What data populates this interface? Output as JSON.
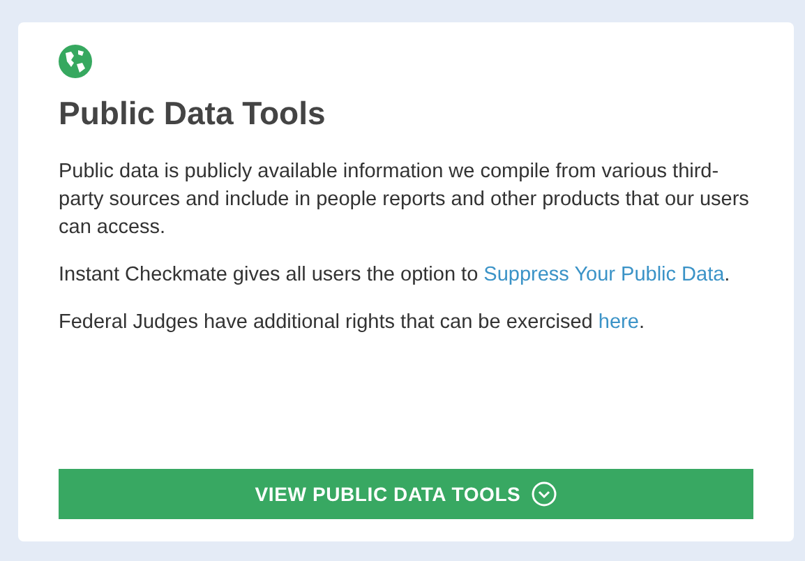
{
  "card": {
    "title": "Public Data Tools",
    "paragraphs": [
      {
        "text": "Public data is publicly available information we compile from various third-party sources and include in people reports and other products that our users can access."
      },
      {
        "text": "Instant Checkmate gives all users the option to ",
        "link": "Suppress Your Public Data",
        "after": "."
      },
      {
        "text": "Federal Judges have additional rights that can be exercised ",
        "link": "here",
        "after": "."
      }
    ],
    "button": "VIEW PUBLIC DATA TOOLS"
  }
}
